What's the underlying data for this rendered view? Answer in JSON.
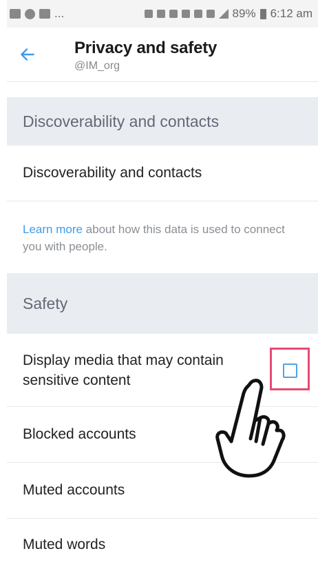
{
  "status_bar": {
    "left_text": "...",
    "battery": "89%",
    "time": "6:12 am"
  },
  "header": {
    "title": "Privacy and safety",
    "handle": "@IM_org"
  },
  "sections": {
    "discoverability_header": "Discoverability and contacts",
    "discoverability_row": "Discoverability and contacts",
    "info_link": "Learn more",
    "info_text": " about how this data is used to connect you with people.",
    "safety_header": "Safety",
    "display_media": "Display media that may contain sensitive content",
    "display_media_checked": false,
    "blocked": "Blocked accounts",
    "muted": "Muted accounts",
    "muted_words": "Muted words"
  },
  "colors": {
    "accent": "#3d9be9",
    "highlight": "#e84a72",
    "section_bg": "#e9edf1"
  }
}
